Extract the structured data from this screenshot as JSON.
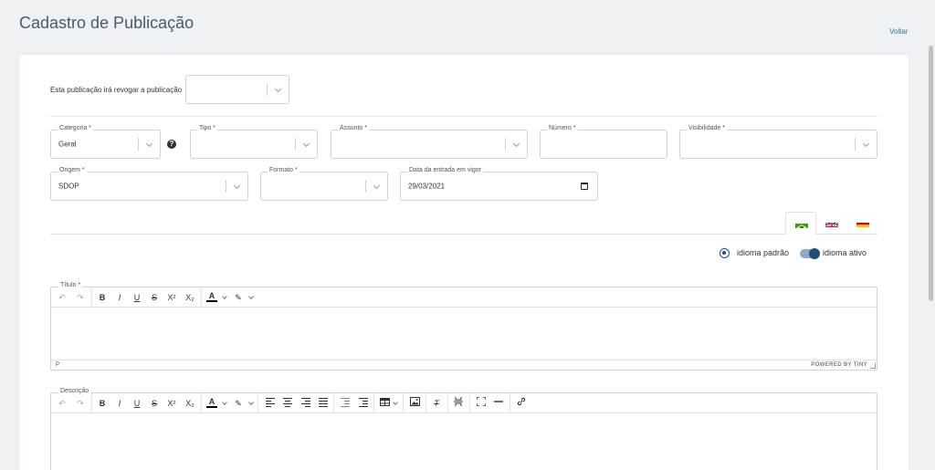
{
  "header": {
    "title": "Cadastro de Publicação",
    "back_label": "Voltar"
  },
  "form": {
    "revoke_label": "Esta publicação irá revogar a publicação",
    "categoria": {
      "label": "Categoria *",
      "value": "Geral"
    },
    "tipo": {
      "label": "Tipo *",
      "value": ""
    },
    "assunto": {
      "label": "Assunto *",
      "value": ""
    },
    "numero": {
      "label": "Número *",
      "value": ""
    },
    "visibilidade": {
      "label": "Visibilidade *",
      "value": ""
    },
    "origem": {
      "label": "Origem *",
      "value": "SDOP"
    },
    "formato": {
      "label": "Formato *",
      "value": ""
    },
    "data_entrada": {
      "label": "Data da entrada em vigor",
      "value": "29/03/2021"
    }
  },
  "language": {
    "tabs": [
      {
        "name": "pt-br",
        "flag_icon": "brazil-flag-icon"
      },
      {
        "name": "en",
        "flag_icon": "uk-flag-icon"
      },
      {
        "name": "es",
        "flag_icon": "spain-flag-icon"
      }
    ],
    "default_label": "idioma padrão",
    "active_label": "idioma ativo"
  },
  "editor_titulo": {
    "label": "Título *",
    "status_path": "P",
    "powered_by": "POWERED BY TINY"
  },
  "editor_descricao": {
    "label": "Descrição"
  },
  "toolbar_glyphs": {
    "bold": "B",
    "italic": "I",
    "underline": "U",
    "strike": "S",
    "superscript": "X²",
    "subscript": "X₂",
    "text_color": "A"
  },
  "colors": {
    "accent": "#1f4e79",
    "link": "#3a6ea5",
    "border": "#cfd4d9",
    "background": "#eef2f5"
  }
}
